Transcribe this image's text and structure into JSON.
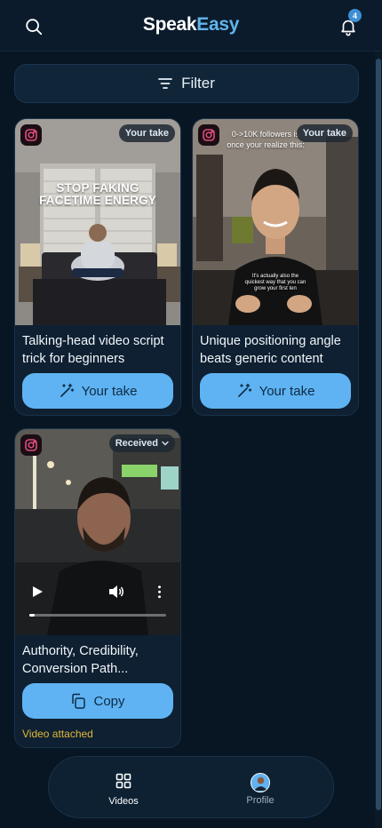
{
  "header": {
    "brand_part1": "Speak",
    "brand_part2": "Easy",
    "notification_count": "4"
  },
  "filter": {
    "label": "Filter"
  },
  "cards": [
    {
      "platform_icon": "instagram-icon",
      "tag": "Your take",
      "overlay_line1": "STOP FAKING",
      "overlay_line2": "FACETIME ENERGY",
      "title": "Talking-head video script trick for beginners",
      "button_label": "Your take",
      "button_icon": "magic-wand-icon"
    },
    {
      "platform_icon": "instagram-icon",
      "tag": "Your take",
      "overlay_top_line1": "0->10K followers is",
      "overlay_top_line2": "once your realize this:",
      "caption_line1": "It's actually also the",
      "caption_line2": "quickest way that you can",
      "caption_line3": "grow your first ten",
      "title": "Unique positioning angle beats generic content",
      "button_label": "Your take",
      "button_icon": "magic-wand-icon"
    },
    {
      "platform_icon": "instagram-icon",
      "tag": "Received",
      "title": "Authority, Credibility, Conversion Path...",
      "button_label": "Copy",
      "button_icon": "copy-icon",
      "status": "Video attached",
      "video_progress": 0.03
    }
  ],
  "nav": {
    "items": [
      {
        "label": "Videos",
        "icon": "grid-icon",
        "active": true
      },
      {
        "label": "Profile",
        "icon": "avatar",
        "active": false
      }
    ]
  },
  "colors": {
    "background": "#081624",
    "accent": "#5fb3f2",
    "brand_accent": "#62b4ee",
    "status_yellow": "#e0b73a"
  }
}
